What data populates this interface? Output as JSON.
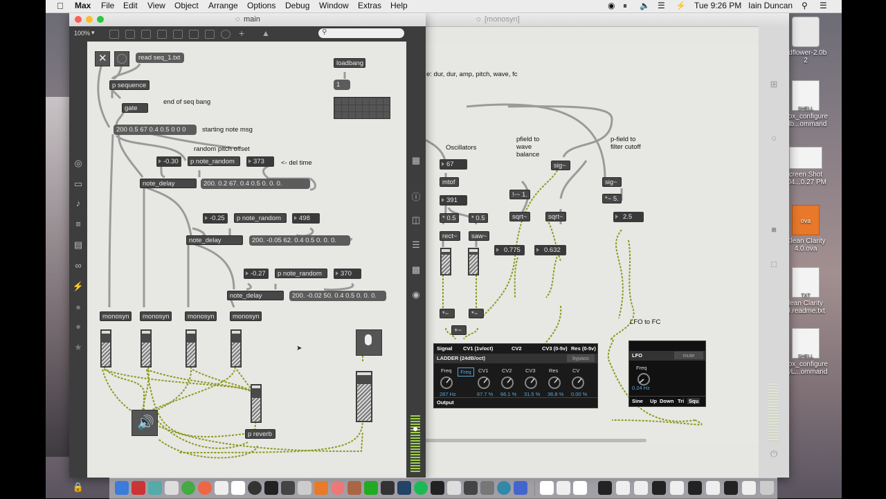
{
  "menubar": {
    "app": "Max",
    "items": [
      "File",
      "Edit",
      "View",
      "Object",
      "Arrange",
      "Options",
      "Debug",
      "Window",
      "Extras",
      "Help"
    ],
    "battery": "⚡",
    "clock": "Tue 9:26 PM",
    "user": "Iain Duncan"
  },
  "main_window": {
    "title": "main",
    "zoom": "100%",
    "zoom_arrow": "▾",
    "objects": {
      "read_msg": "read seq_1.txt",
      "p_sequence": "p sequence",
      "gate": "gate",
      "loadbang": "loadbang",
      "one": "1",
      "start_msg": "200 0.5 67 0.4 0.5 0 0 0",
      "nr1_num": "-0.30",
      "nr1": "p note_random",
      "nr1_del": "373",
      "nd1": "note_delay",
      "nd1_msg": "200. 0.2 67. 0.4 0.5 0. 0. 0.",
      "nr2_num": "-0.25",
      "nr2": "p note_random",
      "nr2_del": "498",
      "nd2": "note_delay",
      "nd2_msg": "200. -0.05 62. 0.4 0.5 0. 0. 0.",
      "nr3_num": "-0.27",
      "nr3": "p note_random",
      "nr3_del": "370",
      "nd3": "note_delay",
      "nd3_msg": "200. -0.02 50. 0.4 0.5 0. 0. 0.",
      "mono1": "monosyn",
      "mono2": "monosyn",
      "mono3": "monosyn",
      "mono4": "monosyn",
      "reverb": "p reverb"
    },
    "comments": {
      "end_seq": "end of seq bang",
      "start_note": "starting note msg",
      "rand_pitch": "random pitch offset",
      "del_time": "<- del time"
    },
    "meters": [
      {
        "name": "mono1",
        "level": 0.8
      },
      {
        "name": "mono2",
        "level": 0.8
      },
      {
        "name": "mono3",
        "level": 0.8
      },
      {
        "name": "mono4",
        "level": 0.8
      },
      {
        "name": "reverb",
        "level": 0.78
      },
      {
        "name": "mic",
        "level": 0.85
      }
    ]
  },
  "mono_window": {
    "title": "[monosyn]",
    "comments": {
      "args": "e: dur, dur, amp, pitch, wave, fc",
      "oscillators": "Oscillators",
      "pfield_wave": "pfield to\nwave\nbalance",
      "pfield_filter": "p-field to\nfilter cutoff",
      "lfo_to_fc": "LFO to FC"
    },
    "objects": {
      "pitch": "67",
      "mtof": "mtof",
      "freq": "391",
      "mul1": "* 0.5",
      "mul2": "* 0.5",
      "rect": "rect~",
      "saw": "saw~",
      "rsub": "!-~ 1.",
      "sqrt1": "sqrt~",
      "sqrt2": "sqrt~",
      "sig1": "sig~",
      "sig2": "sig~",
      "mul5": "*~ 5.",
      "val1": "0.775",
      "val2": "0.632",
      "val3": "2.5",
      "m1": "*~",
      "m2": "*~",
      "plus": "+~"
    },
    "ladder": {
      "header": [
        "Signal",
        "CV1 (1v/oct)",
        "CV2",
        "CV3 (0-5v)",
        "Res (0-5v)"
      ],
      "title": "LADDER (24dB/oct)",
      "bypass": "bypass",
      "knobs": [
        {
          "label": "Freq",
          "value": "287 Hz"
        },
        {
          "label": "CV1",
          "value": "67.7 %"
        },
        {
          "label": "CV2",
          "value": "66.1 %"
        },
        {
          "label": "CV3",
          "value": "31.5 %"
        },
        {
          "label": "Res",
          "value": "36.8 %"
        },
        {
          "label": "CV",
          "value": "0.00 %"
        }
      ],
      "freq_btn": "Freq",
      "output": "Output"
    },
    "lfo": {
      "title": "LFO",
      "mute": "mute",
      "knob_label": "Freq",
      "knob_value": "0.24 Hz",
      "waves": [
        "Sine",
        "Up",
        "Down",
        "Tri",
        "Squ"
      ]
    }
  },
  "desktop": {
    "icons": [
      "ndflower-2.0b\n2",
      "Box_configure\nalb...ommand",
      "creen Shot\n-04...0.27 PM",
      "Clean Clarity\n4.0.ova",
      "lean Clarity\n0.readme.txt",
      "Box_configure\nityL...ommand"
    ],
    "shell_label": "SHELL",
    "ova_label": "ova",
    "txt_label": "TXT"
  },
  "colors": {
    "max_dark": "#3d3d3d",
    "patch_bg": "#e7e7e3",
    "cord_yellow": "#b8c23a",
    "ladder_blue": "#5aa8d8"
  }
}
